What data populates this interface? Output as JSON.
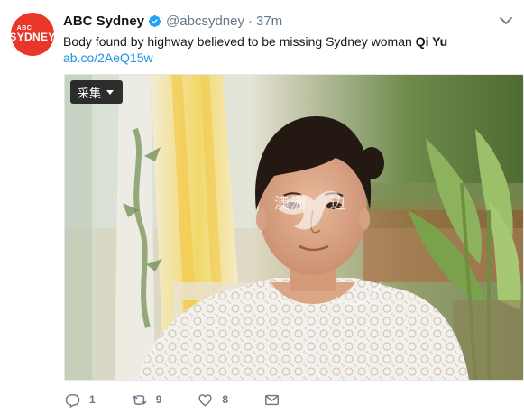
{
  "tweet": {
    "avatar_top": "ABC",
    "avatar_bottom": "SYDNEY",
    "author_name": "ABC Sydney",
    "handle": "@abcsydney",
    "separator": "·",
    "time": "37m",
    "text_pre": "Body found by highway believed to be missing Sydney woman ",
    "text_bold": "Qi Yu",
    "link": "ab.co/2AeQ15w"
  },
  "media": {
    "collect_label": "采集",
    "watermark": "澳洲    边"
  },
  "actions": {
    "reply_count": "1",
    "retweet_count": "9",
    "like_count": "8"
  },
  "colors": {
    "brand_red": "#e8362a",
    "link_blue": "#1b95e0",
    "muted": "#657786",
    "verified_blue": "#1da1f2"
  }
}
